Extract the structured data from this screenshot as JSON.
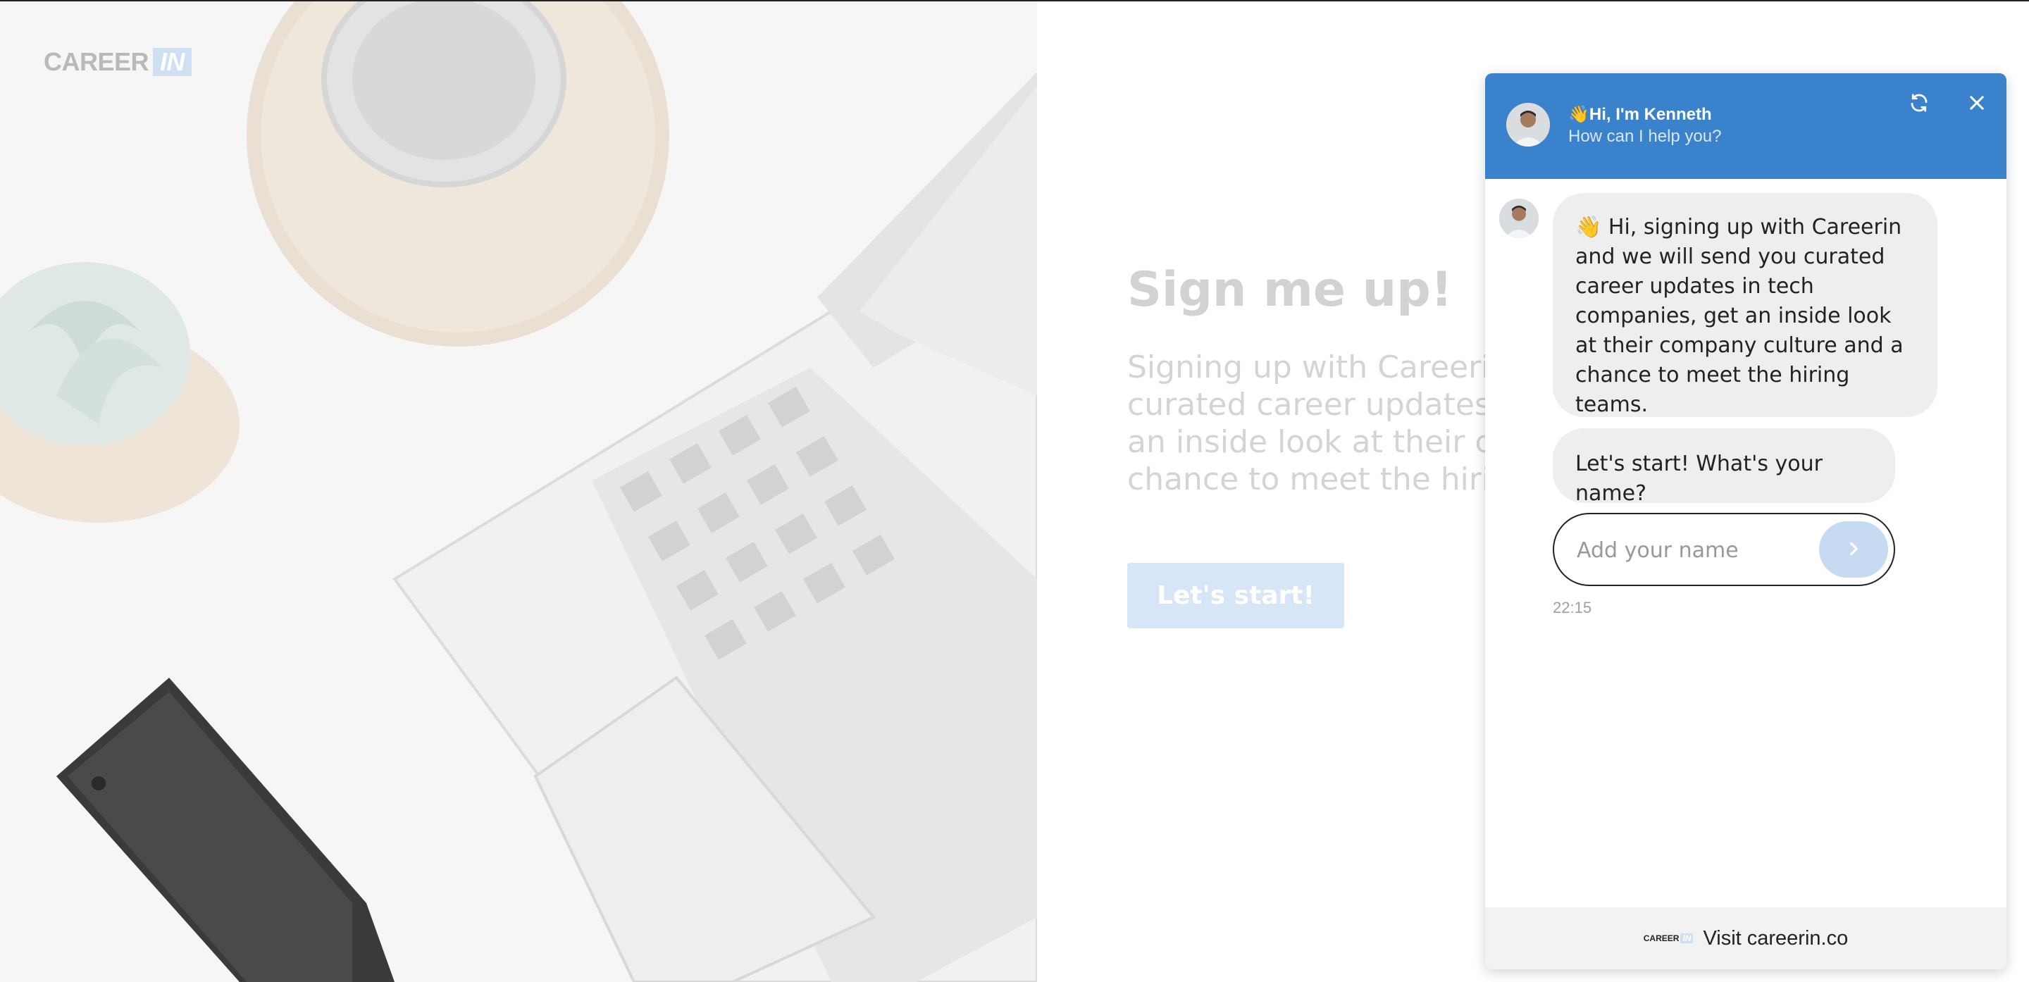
{
  "brand": {
    "logo_text": "CAREER",
    "logo_badge": "IN"
  },
  "signup": {
    "heading": "Sign me up!",
    "body": "Signing up with Careerin and we will send you curated career updates in tech companies, get an inside look at their company culture and a chance to meet the hiring teams.",
    "button_label": "Let's start!"
  },
  "chat": {
    "header_title": "👋Hi, I'm Kenneth",
    "header_subtitle": "How can I help you?",
    "messages": [
      "👋 Hi, signing up with Careerin and we will send you curated career updates in tech companies, get an inside look at their company culture and a chance to meet the hiring teams.",
      "Let's start! What's your name?"
    ],
    "name_input": {
      "placeholder": "Add your name",
      "value": ""
    },
    "timestamp": "22:15",
    "footer_link": "Visit careerin.co",
    "footer_logo_text": "CAREER",
    "footer_logo_badge": "IN"
  },
  "icons": {
    "refresh": "refresh-icon",
    "close": "close-icon",
    "send": "chevron-right-icon"
  },
  "colors": {
    "chat_header": "#3b82cc",
    "send_button": "#c6dbf2",
    "start_button": "#d6e6f6",
    "bubble": "#eeeeee"
  }
}
